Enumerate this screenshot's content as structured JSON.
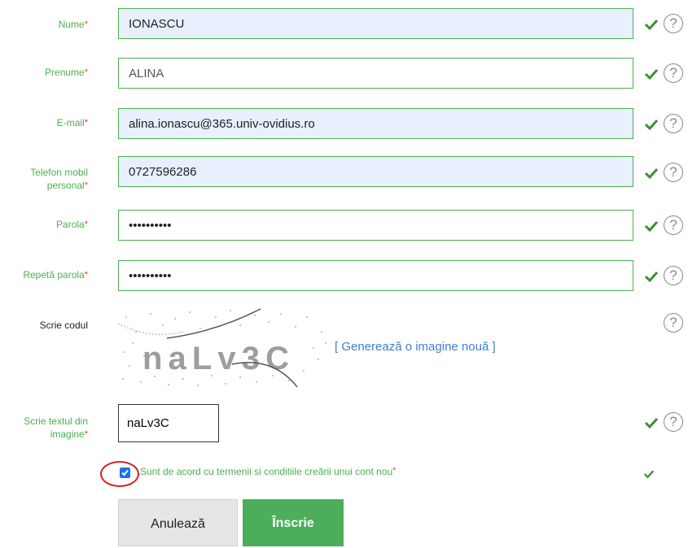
{
  "form": {
    "required_mark": "*",
    "fields": [
      {
        "label": "Nume",
        "value": "IONASCU"
      },
      {
        "label": "Prenume",
        "value": "ALINA"
      },
      {
        "label": "E-mail",
        "value": "alina.ionascu@365.univ-ovidius.ro"
      },
      {
        "label": "Telefon mobil",
        "label2": "personal",
        "value": "0727596286"
      },
      {
        "label": "Parola",
        "value": "••••••••••"
      },
      {
        "label": "Repetă parola",
        "value": "••••••••••"
      }
    ],
    "captcha": {
      "label": "Scrie codul",
      "image_text": "naLv3C",
      "regenerate_link": "[ Generează o imagine nouă ]"
    },
    "captcha_input": {
      "label": "Scrie textul din",
      "label2": "imagine",
      "value": "naLv3C"
    },
    "terms": {
      "text": "Sunt de acord cu termenii si conditiile creării unui cont nou",
      "checked": true
    },
    "help_glyph": "?",
    "buttons": {
      "cancel": "Anulează",
      "submit": "Înscrie"
    }
  },
  "colors": {
    "accent_green": "#4caf50",
    "required_red": "#e53935",
    "link_blue": "#3f7fd1",
    "autofill_bg": "#e8f0fe"
  },
  "icons": [
    "check-icon",
    "help-icon"
  ]
}
